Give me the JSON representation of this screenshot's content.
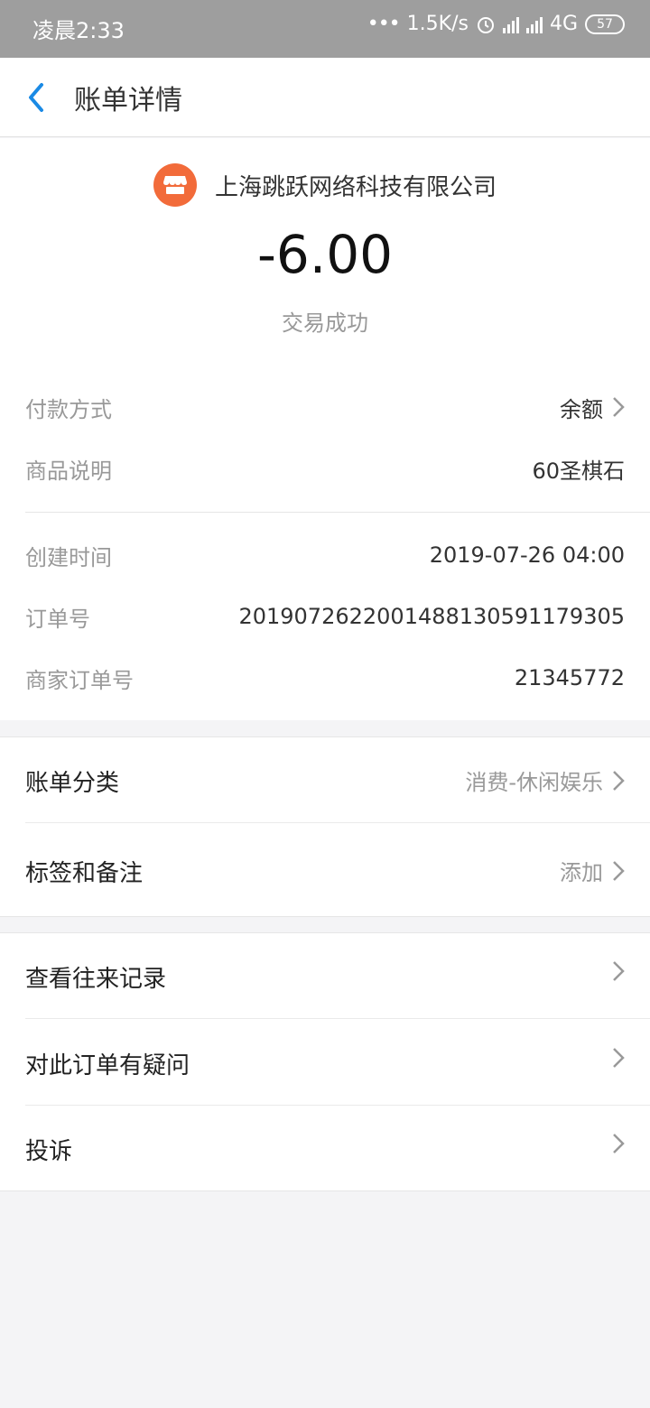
{
  "status_bar": {
    "time": "凌晨2:33",
    "speed": "1.5K/s",
    "network": "4G",
    "battery": "57"
  },
  "header": {
    "title": "账单详情",
    "back_icon": "chevron-left-icon"
  },
  "summary": {
    "merchant_name": "上海跳跃网络科技有限公司",
    "merchant_icon": "store-icon",
    "merchant_icon_color": "#f26b3a",
    "amount": "-6.00",
    "status": "交易成功"
  },
  "details": [
    {
      "label": "付款方式",
      "value": "余额",
      "has_chevron": true
    },
    {
      "label": "商品说明",
      "value": "60圣棋石"
    }
  ],
  "order_info": [
    {
      "label": "创建时间",
      "value": "2019-07-26 04:00"
    },
    {
      "label": "订单号",
      "value": "2019072622001488130591179305"
    },
    {
      "label": "商家订单号",
      "value": "21345772"
    }
  ],
  "bill_settings": [
    {
      "label": "账单分类",
      "value": "消费-休闲娱乐"
    },
    {
      "label": "标签和备注",
      "value": "添加"
    }
  ],
  "actions": [
    {
      "label": "查看往来记录"
    },
    {
      "label": "对此订单有疑问"
    },
    {
      "label": "投诉"
    }
  ],
  "colors": {
    "accent": "#1a8ae5",
    "status_bar_bg": "#9e9e9e",
    "page_bg": "#f4f4f6"
  }
}
